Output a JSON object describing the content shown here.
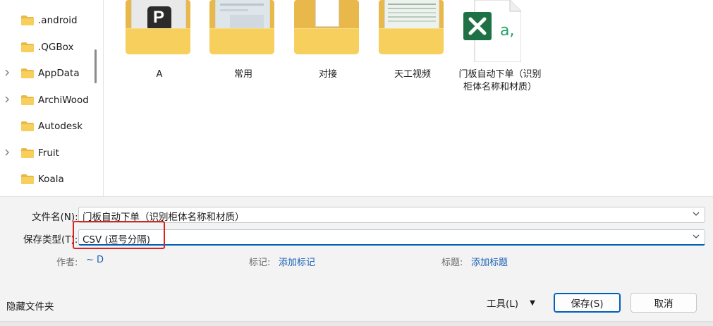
{
  "nav": {
    "items": [
      {
        "label": ".android",
        "expandable": false
      },
      {
        "label": ".QGBox",
        "expandable": false
      },
      {
        "label": "AppData",
        "expandable": true
      },
      {
        "label": "ArchiWood",
        "expandable": true
      },
      {
        "label": "Autodesk",
        "expandable": false
      },
      {
        "label": "Fruit",
        "expandable": true
      },
      {
        "label": "Koala",
        "expandable": false
      }
    ]
  },
  "content": {
    "items": [
      {
        "label": "A",
        "type": "folder"
      },
      {
        "label": "常用",
        "type": "folder"
      },
      {
        "label": "对接",
        "type": "folder"
      },
      {
        "label": "天工视频",
        "type": "folder"
      },
      {
        "label": "门板自动下单（识别柜体名称和材质）",
        "type": "excel-file"
      }
    ]
  },
  "form": {
    "filename_label": "文件名(N):",
    "filename_value": "门板自动下单（识别柜体名称和材质）",
    "filetype_label": "保存类型(T):",
    "filetype_value": "CSV (逗号分隔)",
    "author_label": "作者:",
    "author_value": "~ D",
    "tags_label": "标记:",
    "tags_value": "添加标记",
    "title_label": "标题:",
    "title_value": "添加标题"
  },
  "footer": {
    "hide_folders": "隐藏文件夹",
    "tools": "工具(L)",
    "save": "保存(S)",
    "cancel": "取消"
  },
  "colors": {
    "folder": "#f7cf5c",
    "accent": "#005fb8",
    "link": "#1a5fb4",
    "highlight": "#e0201b",
    "excel": "#1e7145"
  }
}
